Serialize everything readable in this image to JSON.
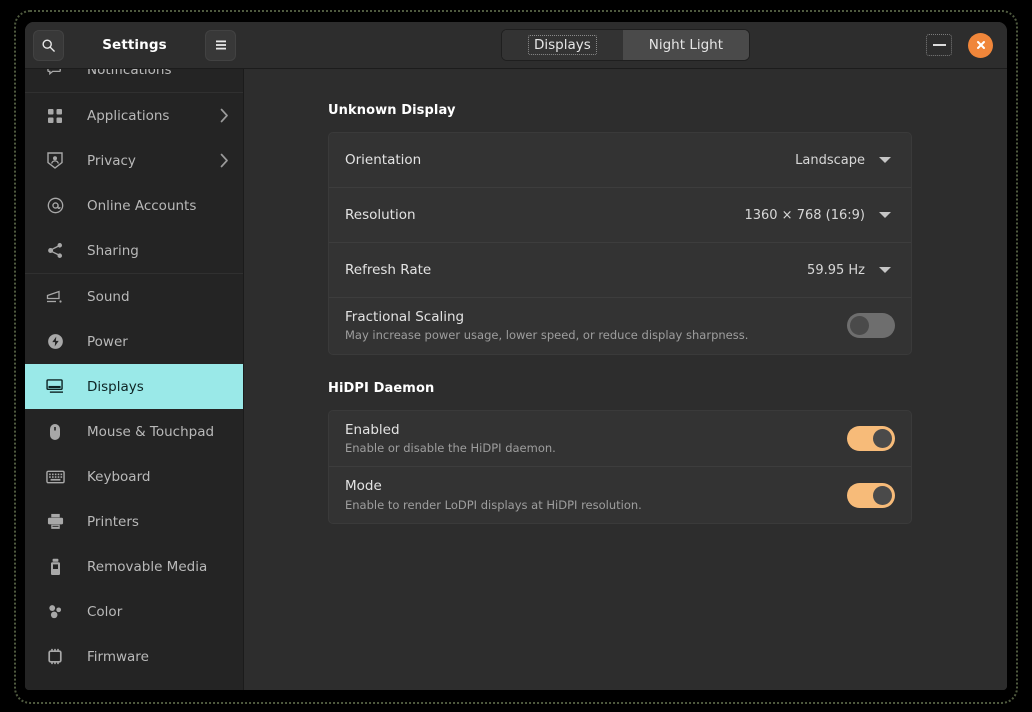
{
  "window": {
    "title": "Settings",
    "search_icon": "search-icon",
    "menu_icon": "hamburger-menu-icon",
    "minimize_label": "Minimize",
    "close_label": "Close",
    "close_color": "#f0863a"
  },
  "tabs": [
    {
      "label": "Displays",
      "active": true
    },
    {
      "label": "Night Light",
      "active": false
    }
  ],
  "sidebar": {
    "selected_color": "#9ae9e8",
    "items": [
      {
        "label": "Notifications",
        "icon": "notifications-icon",
        "chevron": false,
        "selected": false,
        "clipped": true
      },
      {
        "label": "Applications",
        "icon": "applications-icon",
        "chevron": true,
        "selected": false
      },
      {
        "label": "Privacy",
        "icon": "privacy-icon",
        "chevron": true,
        "selected": false
      },
      {
        "label": "Online Accounts",
        "icon": "online-accounts-icon",
        "chevron": false,
        "selected": false
      },
      {
        "label": "Sharing",
        "icon": "sharing-icon",
        "chevron": false,
        "selected": false
      },
      {
        "label": "Sound",
        "icon": "sound-icon",
        "chevron": false,
        "selected": false
      },
      {
        "label": "Power",
        "icon": "power-icon",
        "chevron": false,
        "selected": false
      },
      {
        "label": "Displays",
        "icon": "displays-icon",
        "chevron": false,
        "selected": true
      },
      {
        "label": "Mouse & Touchpad",
        "icon": "mouse-icon",
        "chevron": false,
        "selected": false
      },
      {
        "label": "Keyboard",
        "icon": "keyboard-icon",
        "chevron": false,
        "selected": false
      },
      {
        "label": "Printers",
        "icon": "printer-icon",
        "chevron": false,
        "selected": false
      },
      {
        "label": "Removable Media",
        "icon": "usb-drive-icon",
        "chevron": false,
        "selected": false
      },
      {
        "label": "Color",
        "icon": "color-icon",
        "chevron": false,
        "selected": false
      },
      {
        "label": "Firmware",
        "icon": "firmware-chip-icon",
        "chevron": false,
        "selected": false
      }
    ]
  },
  "main": {
    "sections": [
      {
        "title": "Unknown Display",
        "rows": [
          {
            "kind": "dropdown",
            "title": "Orientation",
            "value": "Landscape"
          },
          {
            "kind": "dropdown",
            "title": "Resolution",
            "value": "1360 × 768 (16:9)"
          },
          {
            "kind": "dropdown",
            "title": "Refresh Rate",
            "value": "59.95 Hz"
          },
          {
            "kind": "toggle",
            "title": "Fractional Scaling",
            "subtitle": "May increase power usage, lower speed, or reduce display sharpness.",
            "state": "off"
          }
        ]
      },
      {
        "title": "HiDPI Daemon",
        "rows": [
          {
            "kind": "toggle",
            "title": "Enabled",
            "subtitle": "Enable or disable the HiDPI daemon.",
            "state": "on"
          },
          {
            "kind": "toggle",
            "title": "Mode",
            "subtitle": "Enable to render LoDPI displays at HiDPI resolution.",
            "state": "on"
          }
        ]
      }
    ]
  },
  "colors": {
    "accent_toggle_on": "#f7bb79",
    "sidebar_selected": "#9ae9e8",
    "close_button": "#f0863a"
  }
}
